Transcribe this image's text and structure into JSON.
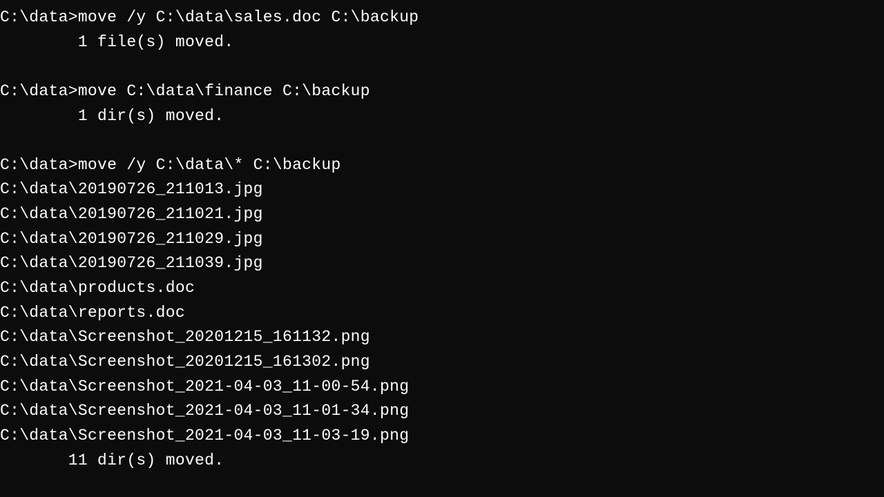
{
  "lines": [
    "C:\\data>move /y C:\\data\\sales.doc C:\\backup",
    "        1 file(s) moved.",
    "",
    "C:\\data>move C:\\data\\finance C:\\backup",
    "        1 dir(s) moved.",
    "",
    "C:\\data>move /y C:\\data\\* C:\\backup",
    "C:\\data\\20190726_211013.jpg",
    "C:\\data\\20190726_211021.jpg",
    "C:\\data\\20190726_211029.jpg",
    "C:\\data\\20190726_211039.jpg",
    "C:\\data\\products.doc",
    "C:\\data\\reports.doc",
    "C:\\data\\Screenshot_20201215_161132.png",
    "C:\\data\\Screenshot_20201215_161302.png",
    "C:\\data\\Screenshot_2021-04-03_11-00-54.png",
    "C:\\data\\Screenshot_2021-04-03_11-01-34.png",
    "C:\\data\\Screenshot_2021-04-03_11-03-19.png",
    "       11 dir(s) moved."
  ]
}
